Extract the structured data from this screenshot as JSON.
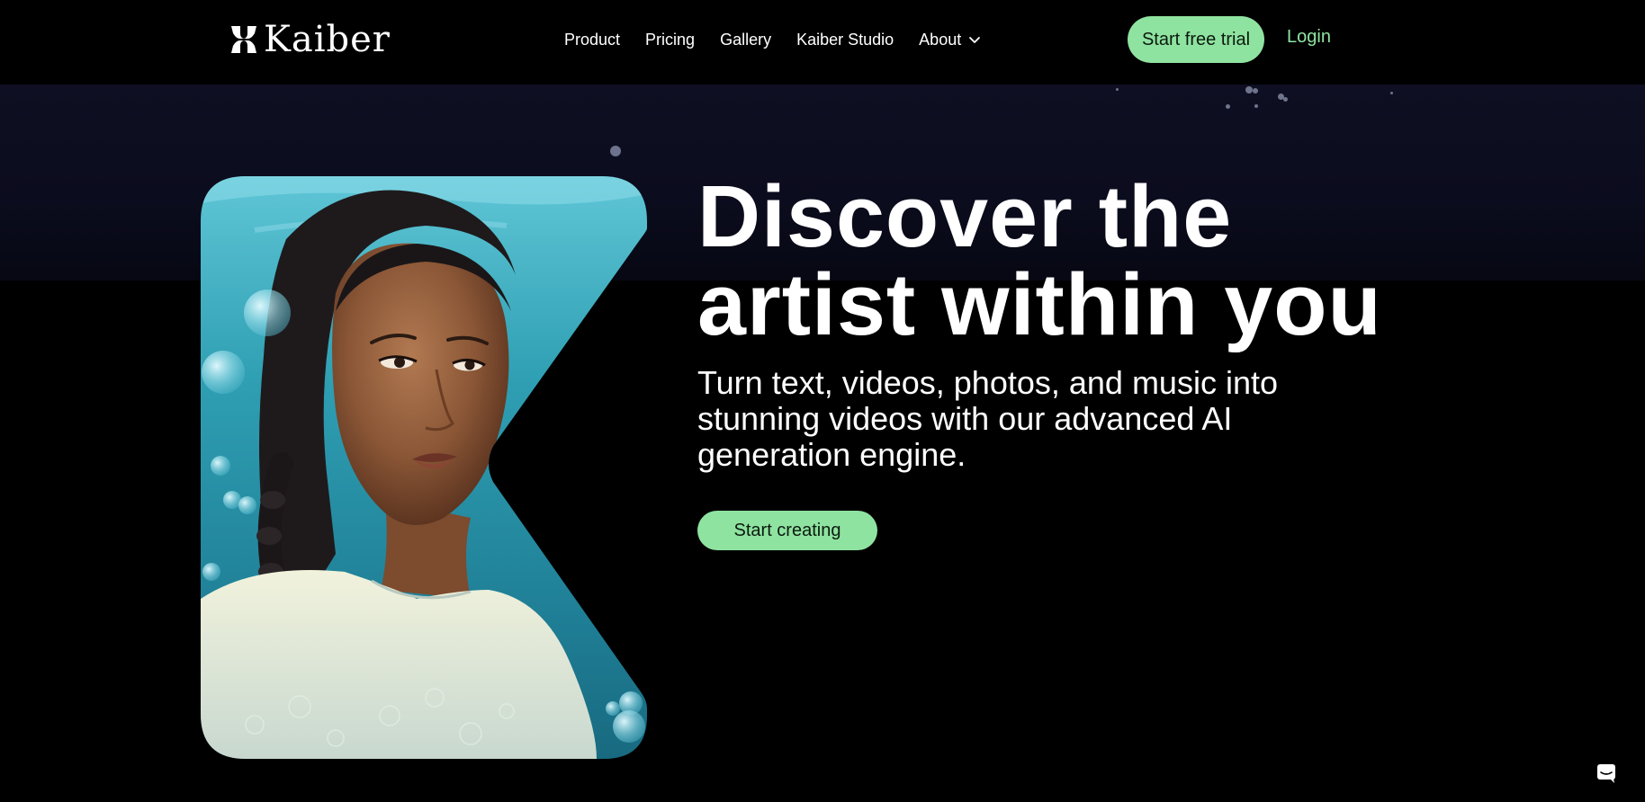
{
  "nav": {
    "logo_text": "Kaiber",
    "links": [
      "Product",
      "Pricing",
      "Gallery",
      "Kaiber Studio",
      "About"
    ],
    "trial_label": "Start free trial",
    "login_label": "Login"
  },
  "hero": {
    "headline_line1": "Discover the",
    "headline_line2": "artist within you",
    "subhead": "Turn text, videos, photos, and music into stunning videos with our advanced AI generation engine.",
    "cta_label": "Start creating"
  },
  "icons": [
    "kaiber-logo-icon",
    "chevron-down-icon",
    "chat-icon"
  ],
  "colors": {
    "background": "#000000",
    "accent_green": "#8fe3a0",
    "text": "#ffffff",
    "night_band": "#0e0f22"
  }
}
